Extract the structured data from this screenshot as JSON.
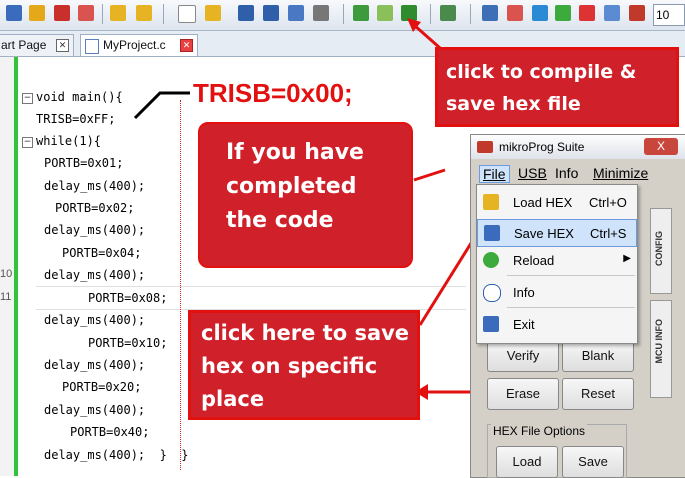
{
  "toolbar": {
    "zoom_value": "10"
  },
  "tabs": [
    {
      "label": "art Page"
    },
    {
      "label": "MyProject.c"
    }
  ],
  "code": {
    "lines": [
      "void main(){",
      "TRISB=0xFF;",
      "while(1){",
      "PORTB=0x01;",
      "delay_ms(400);",
      "PORTB=0x02;",
      "delay_ms(400);",
      "PORTB=0x04;",
      "delay_ms(400);",
      "PORTB=0x08;",
      "delay_ms(400);",
      "PORTB=0x10;",
      "delay_ms(400);",
      "PORTB=0x20;",
      "delay_ms(400);",
      "PORTB=0x40;",
      "delay_ms(400);  }  }"
    ],
    "line_numbers": {
      "ln10": "10",
      "ln11": "11"
    }
  },
  "annotations": {
    "trisb": "TRISB=0x00;",
    "compile": "click to compile & save hex file",
    "completed": "If you have completed the code",
    "click_here": "click here to save hex on specific place"
  },
  "mikroprog": {
    "title": "mikroProg Suite",
    "close": "X",
    "menu": {
      "file": "File",
      "usb": "USB",
      "info": "Info",
      "minimize": "Minimize"
    },
    "dropdown": {
      "load_hex": "Load HEX",
      "load_hex_sc": "Ctrl+O",
      "save_hex": "Save HEX",
      "save_hex_sc": "Ctrl+S",
      "reload": "Reload",
      "info": "Info",
      "exit": "Exit"
    },
    "tabs": {
      "config": "CONFIG",
      "mcu_info": "MCU INFO"
    },
    "buttons": {
      "verify": "Verify",
      "blank": "Blank",
      "erase": "Erase",
      "reset": "Reset",
      "load": "Load",
      "save": "Save"
    },
    "hex_group_label": "HEX File Options"
  }
}
